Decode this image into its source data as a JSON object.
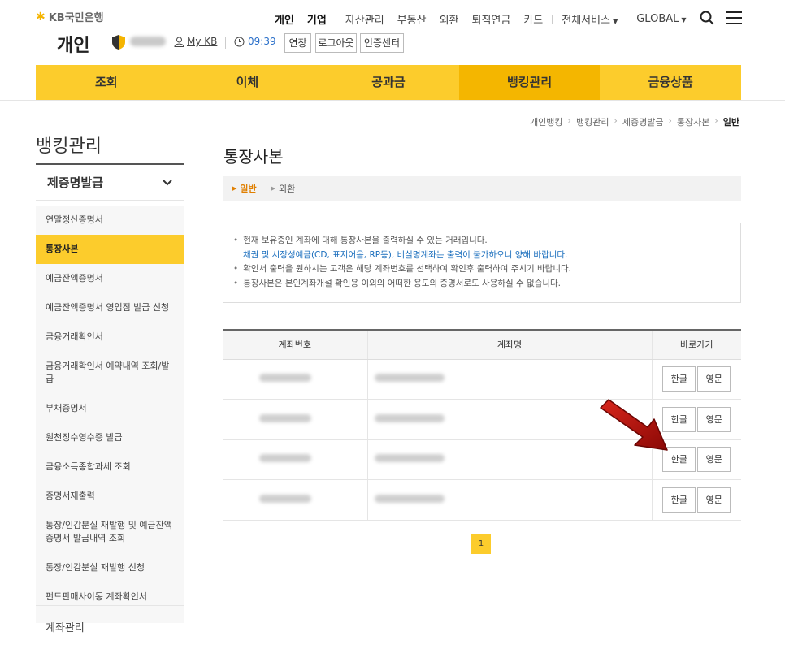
{
  "header": {
    "logo_text": "KB국민은행",
    "page_kind": "개인",
    "mykb": "My KB",
    "time": "09:39",
    "buttons": [
      "연장",
      "로그아웃",
      "인증센터"
    ]
  },
  "topnav": {
    "primary": [
      "개인",
      "기업"
    ],
    "items": [
      "자산관리",
      "부동산",
      "외환",
      "퇴직연금",
      "카드"
    ],
    "all_services": "전체서비스",
    "global": "GLOBAL"
  },
  "gnb": [
    "조회",
    "이체",
    "공과금",
    "뱅킹관리",
    "금융상품"
  ],
  "lnb": {
    "title": "뱅킹관리",
    "group": "제증명발급",
    "items": [
      "연말정산증명서",
      "통장사본",
      "예금잔액증명서",
      "예금잔액증명서 영업점 발급 신청",
      "금융거래확인서",
      "금융거래확인서 예약내역 조회/발급",
      "부채증명서",
      "원천징수영수증 발급",
      "금융소득종합과세 조회",
      "증명서재출력",
      "통장/인감분실 재발행 및 예금잔액증명서 발급내역 조회",
      "통장/인감분실 재발행 신청",
      "펀드판매사이동 계좌확인서"
    ],
    "more": "계좌관리"
  },
  "breadcrumb": [
    "개인뱅킹",
    "뱅킹관리",
    "제증명발급",
    "통장사본",
    "일반"
  ],
  "page_title": "통장사본",
  "subtabs": [
    "일반",
    "외환"
  ],
  "notice": {
    "line1": "현재 보유중인 계좌에 대해 통장사본을 출력하실 수 있는 거래입니다.",
    "line1_blue": "채권 및 시장성예금(CD, 표지어음, RP등), 비실명계좌는 출력이 불가하오니 양해 바랍니다.",
    "line2": "확인서 출력을 원하시는 고객은 해당 계좌번호를 선택하여 확인후 출력하여 주시기 바랍니다.",
    "line3": "통장사본은 본인계좌개설 확인용 이외의 어떠한 용도의 증명서로도 사용하실 수 없습니다."
  },
  "table": {
    "headers": [
      "계좌번호",
      "계좌명",
      "바로가기"
    ],
    "btn_kor": "한글",
    "btn_eng": "영문",
    "row_count": 4
  },
  "pager": "1",
  "colors": {
    "accent": "#fccc2c",
    "active": "#f4b600",
    "link_blue": "#1a6ebd",
    "arrow": "#b80f0a"
  }
}
